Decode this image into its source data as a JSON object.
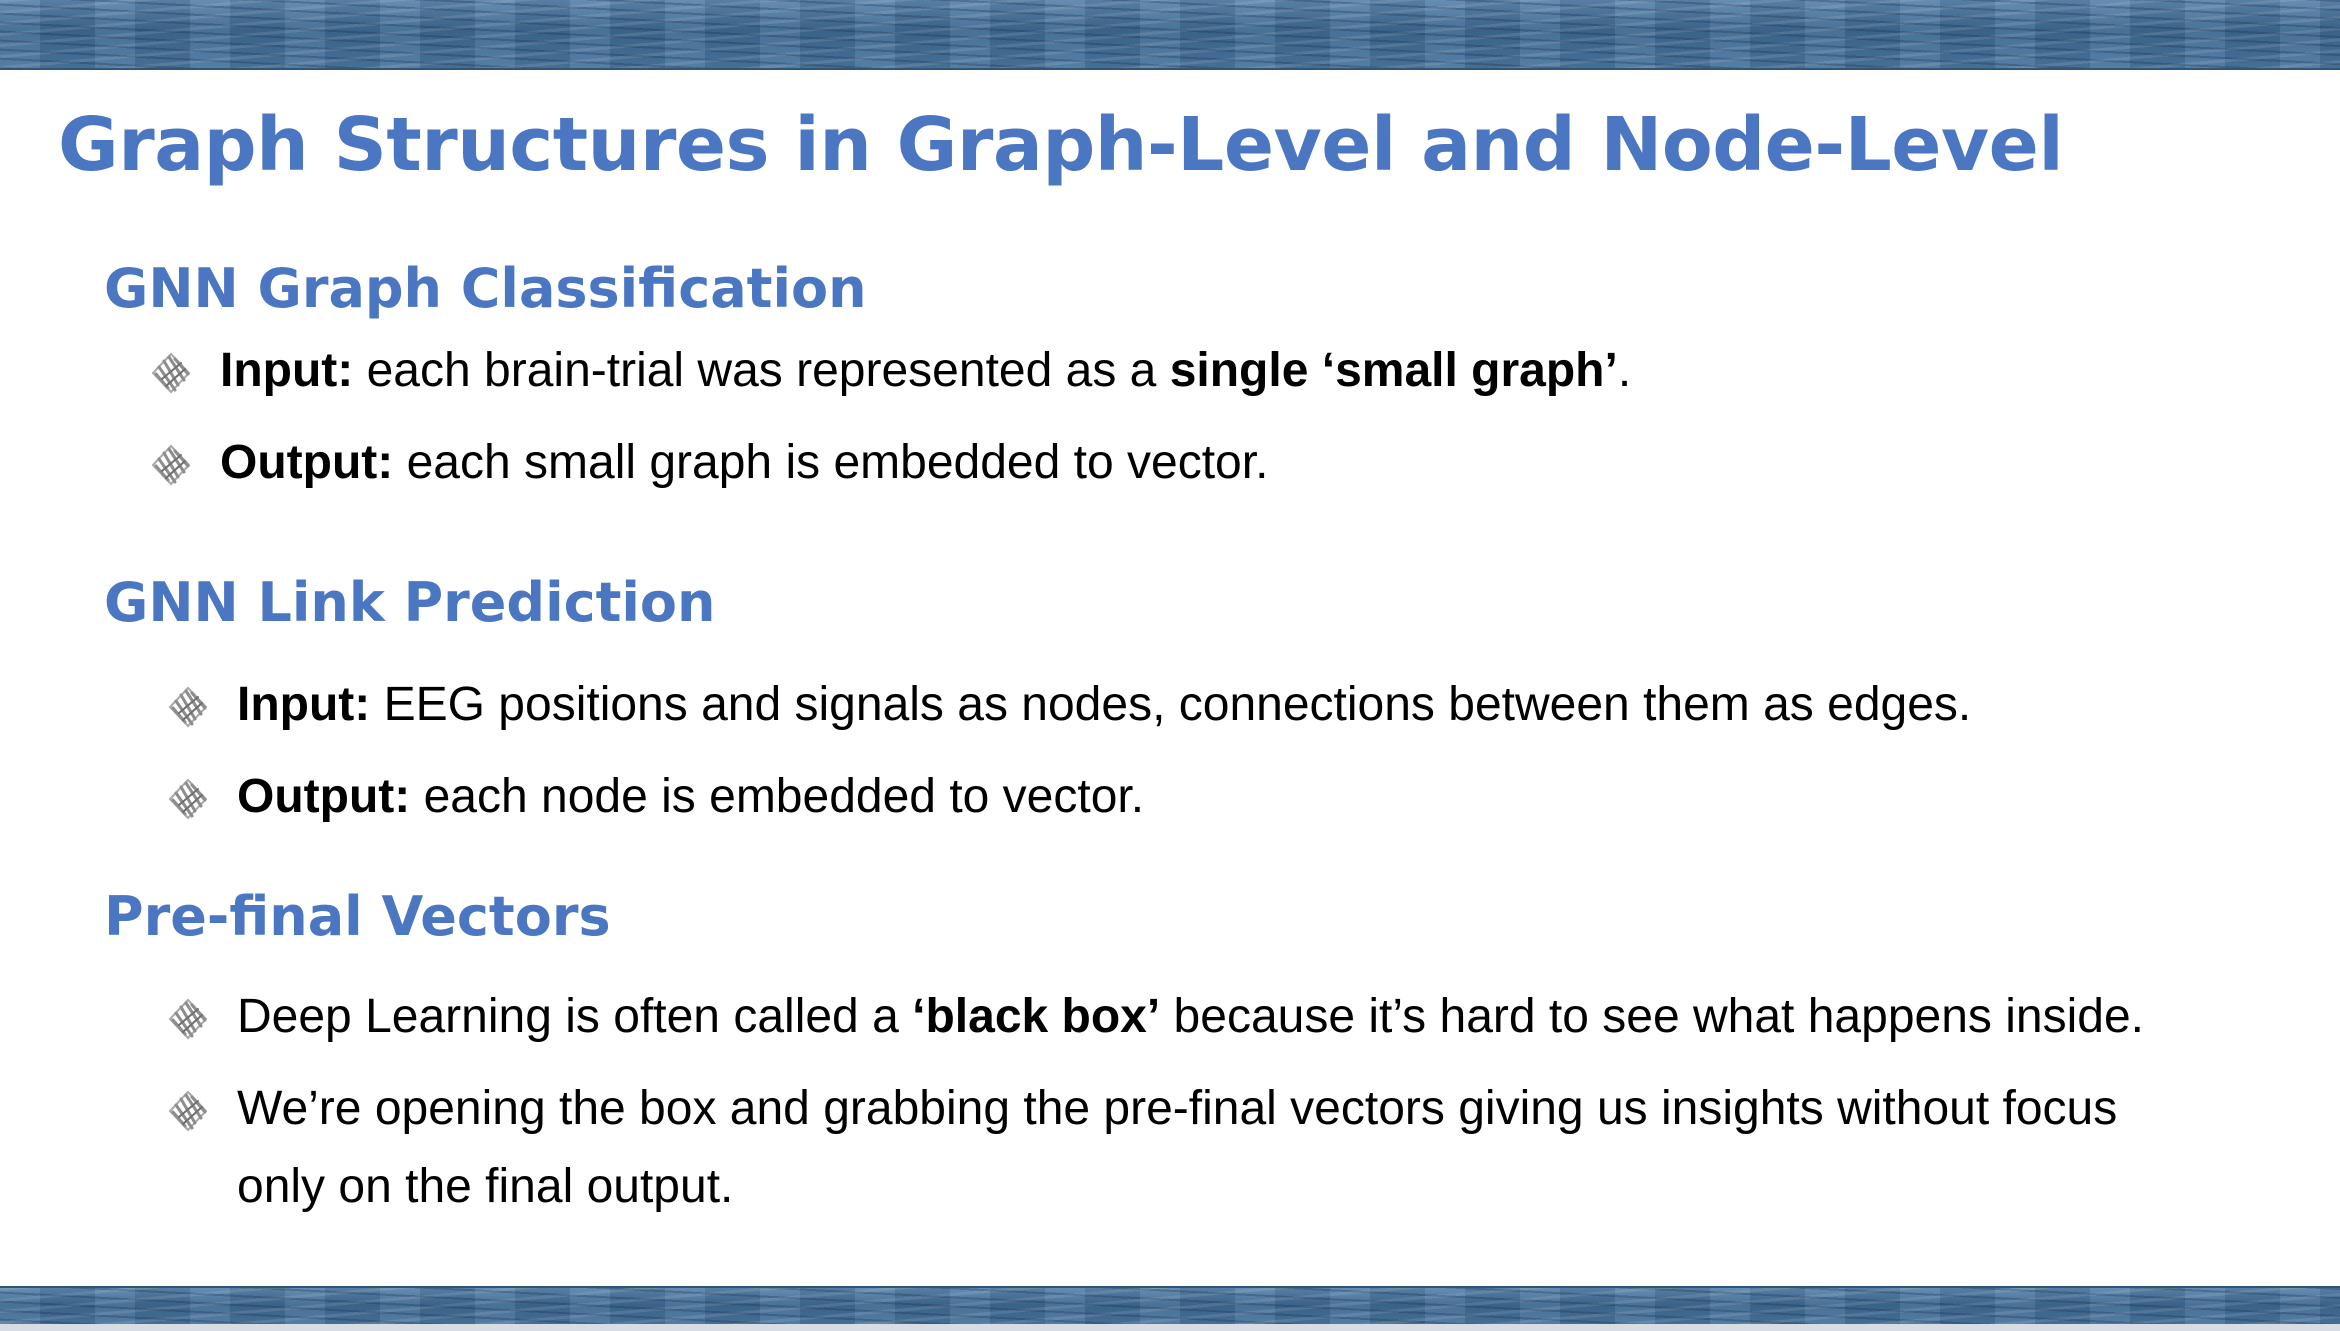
{
  "slide": {
    "title": "Graph Structures in Graph-Level and Node-Level",
    "colors": {
      "heading": "#4a76c2",
      "band": "#3f6b93",
      "text": "#000000"
    },
    "bullet_icon": "sketch-diamond-icon",
    "sections": [
      {
        "heading": "GNN Graph Classification",
        "bullets": [
          {
            "label": "Input:",
            "text_a": " each brain-trial was represented as a ",
            "emphasis": "single ‘small graph’",
            "text_b": "."
          },
          {
            "label": "Output:",
            "text_a": " each small graph is embedded to vector."
          }
        ]
      },
      {
        "heading": "GNN Link Prediction",
        "bullets": [
          {
            "label": "Input:",
            "text_a": " EEG positions and signals as nodes, connections between them as edges."
          },
          {
            "label": "Output:",
            "text_a": " each node is embedded to vector."
          }
        ]
      },
      {
        "heading": "Pre-final Vectors",
        "bullets": [
          {
            "text_a": "Deep Learning is often called a ",
            "emphasis": "‘black box’",
            "text_b": " because it’s hard to see what happens inside."
          },
          {
            "line_1": "We’re opening the box and grabbing the pre-final vectors giving us insights without focus",
            "line_2": "only on the final output."
          }
        ]
      }
    ]
  }
}
